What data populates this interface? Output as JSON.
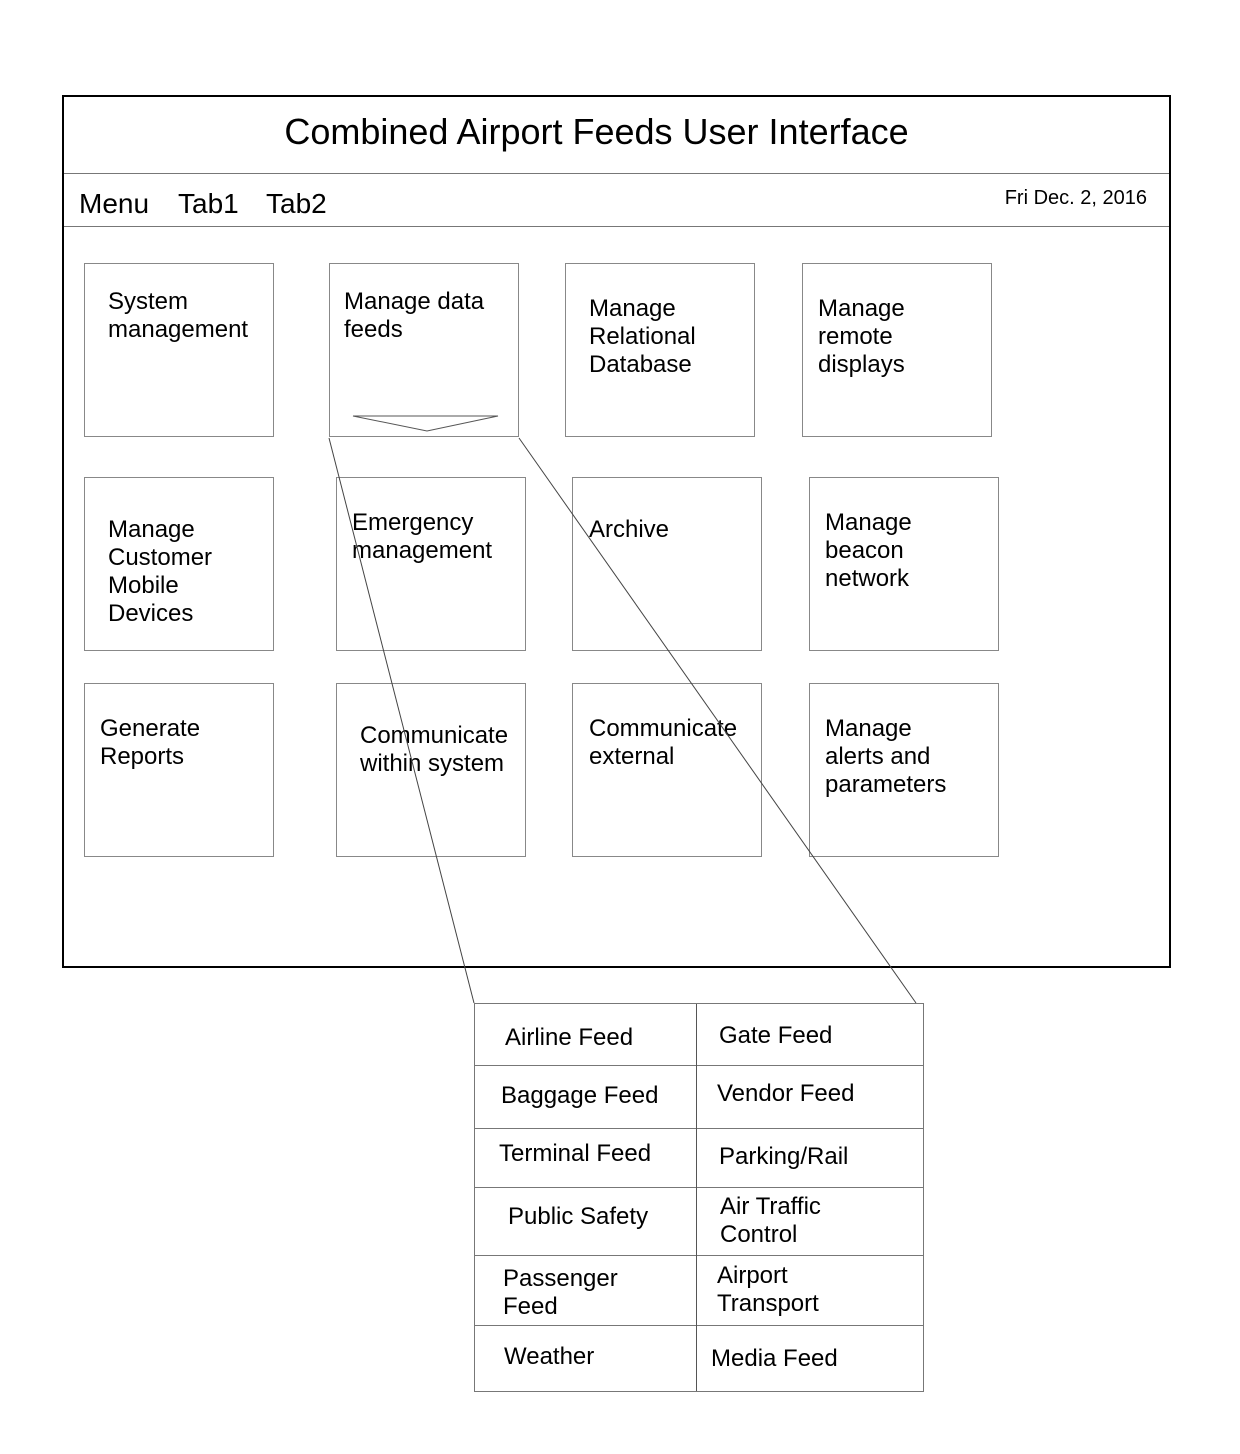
{
  "window": {
    "title": "Combined Airport Feeds User Interface",
    "nav": {
      "items": [
        {
          "label": "Menu"
        },
        {
          "label": "Tab1"
        },
        {
          "label": "Tab2"
        }
      ],
      "date": "Fri Dec. 2, 2016"
    },
    "tiles": [
      {
        "label": "System\nmanagement"
      },
      {
        "label": "Manage data\nfeeds",
        "has_dropdown": true,
        "dropdown_icon": "chevron-down-icon"
      },
      {
        "label": "Manage\nRelational\nDatabase"
      },
      {
        "label": "Manage\nremote\ndisplays"
      },
      {
        "label": "Manage\nCustomer\nMobile\nDevices"
      },
      {
        "label": "Emergency\nmanagement"
      },
      {
        "label": "Archive"
      },
      {
        "label": "Manage\nbeacon\nnetwork"
      },
      {
        "label": "Generate\nReports"
      },
      {
        "label": "Communicate\nwithin system"
      },
      {
        "label": "Communicate\nexternal"
      },
      {
        "label": "Manage\nalerts and\nparameters"
      }
    ]
  },
  "data_feeds_popup": {
    "rows": [
      [
        "Airline Feed",
        "Gate Feed"
      ],
      [
        "Baggage Feed",
        "Vendor Feed"
      ],
      [
        "Terminal Feed",
        "Parking/Rail"
      ],
      [
        "Public Safety",
        "Air Traffic\nControl"
      ],
      [
        "Passenger\nFeed",
        "Airport\nTransport"
      ],
      [
        "Weather",
        "Media Feed"
      ]
    ]
  }
}
